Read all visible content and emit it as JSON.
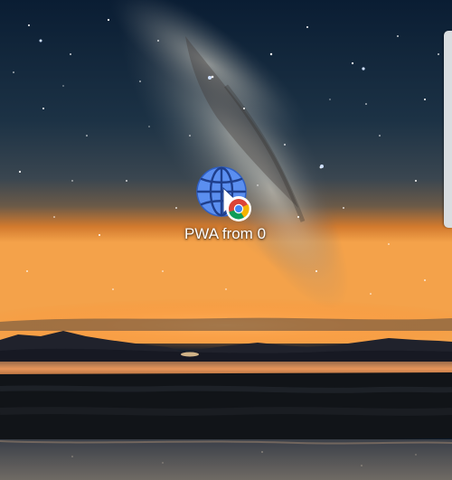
{
  "home_screen": {
    "shortcut": {
      "label": "PWA from 0",
      "icon": "globe-icon",
      "badge_icon": "chrome-icon",
      "icon_color": "#5b8ff0"
    },
    "edge_panel": {
      "icon": "edge-panel-handle"
    }
  },
  "colors": {
    "sky_top": "#0a1d33",
    "horizon_glow": "#f07a1c",
    "water": "#f0a055"
  }
}
